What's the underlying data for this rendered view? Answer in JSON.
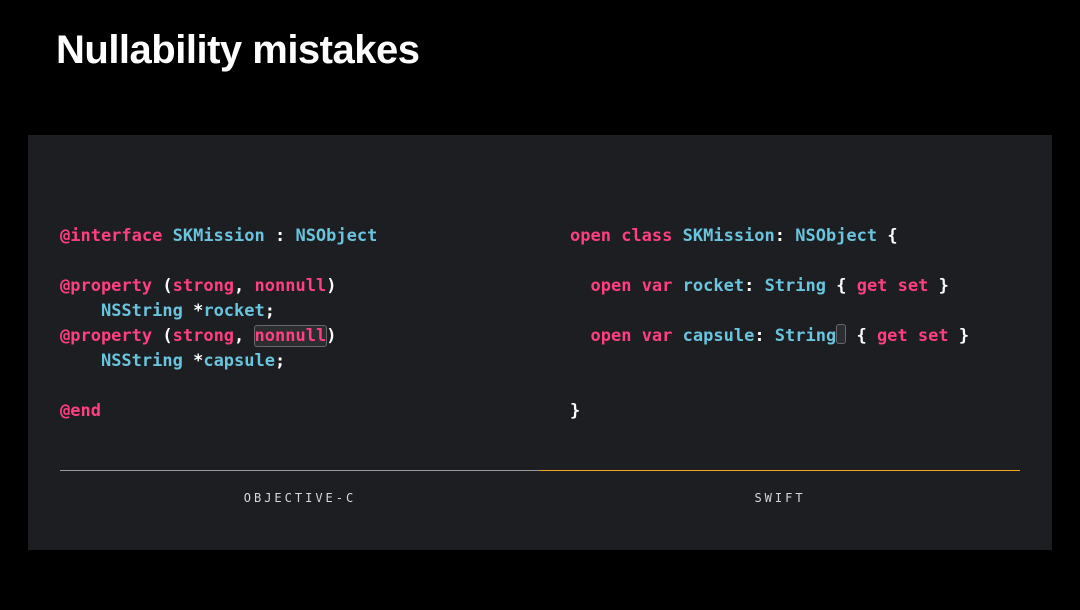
{
  "title": "Nullability mistakes",
  "left": {
    "lang_label": "OBJECTIVE-C",
    "code": {
      "l1": {
        "at_interface": "@interface",
        "sp": " ",
        "cls": "SKMission",
        "colon": " : ",
        "super": "NSObject"
      },
      "l2": "",
      "l3": {
        "at_property": "@property",
        "sp": " ",
        "paren_open": "(",
        "strong": "strong",
        "comma": ", ",
        "nonnull": "nonnull",
        "paren_close": ")"
      },
      "l4": {
        "indent": "    ",
        "ns": "NSString ",
        "star": "*",
        "name": "rocket",
        "semi": ";"
      },
      "l5": {
        "at_property": "@property",
        "sp": " ",
        "paren_open": "(",
        "strong": "strong",
        "comma": ", ",
        "nonnull": "nonnull",
        "paren_close": ")"
      },
      "l6": {
        "indent": "    ",
        "ns": "NSString ",
        "star": "*",
        "name": "capsule",
        "semi": ";"
      },
      "l7": "",
      "l8": {
        "at_end": "@end"
      }
    }
  },
  "right": {
    "lang_label": "SWIFT",
    "code": {
      "l1": {
        "open": "open",
        "sp": " ",
        "class": "class",
        "sp2": " ",
        "cls": "SKMission",
        "colon": ": ",
        "super": "NSObject",
        "brace": " {"
      },
      "l2": "",
      "l3": {
        "indent": "  ",
        "open": "open",
        "sp": " ",
        "var": "var",
        "sp2": " ",
        "name": "rocket",
        "colon": ": ",
        "type": "String",
        "sp3": " { ",
        "get": "get",
        "sp4": " ",
        "set": "set",
        "end": " }"
      },
      "l4": "",
      "l5": {
        "indent": "  ",
        "open": "open",
        "sp": " ",
        "var": "var",
        "sp2": " ",
        "name": "capsule",
        "colon": ": ",
        "type": "String",
        "sp3": " { ",
        "get": "get",
        "sp4": " ",
        "set": "set",
        "end": " }"
      },
      "l6": "",
      "l7": "",
      "l8": {
        "brace": "}"
      }
    }
  }
}
